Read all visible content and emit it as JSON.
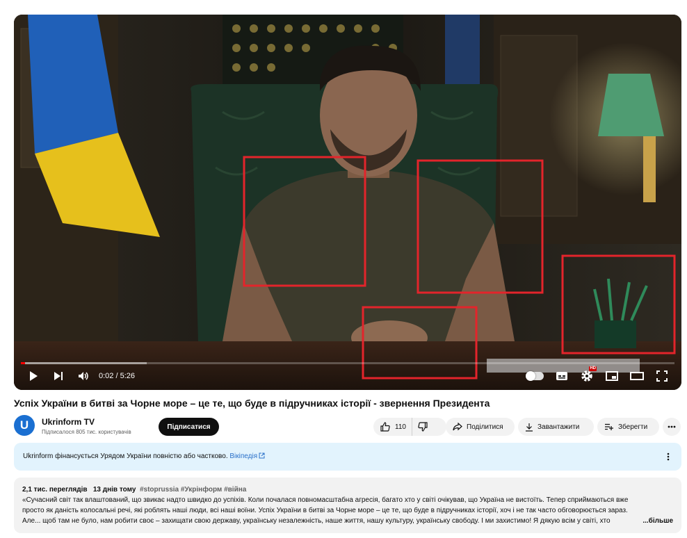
{
  "player": {
    "time_current": "0:02",
    "time_separator": " / ",
    "time_total": "5:26",
    "progress_fraction": 0.0061,
    "hd_badge": "HD",
    "colors": {
      "progress": "#ff0000",
      "highlight_box": "#e3242b"
    }
  },
  "video": {
    "title": "Успіх України в битві за Чорне море – це те, що буде в підручниках історії - звернення Президента"
  },
  "channel": {
    "avatar_letter": "U",
    "name": "Ukrinform TV",
    "subscribers": "Підписалося 805 тис. користувачів",
    "subscribe_label": "Підписатися"
  },
  "actions": {
    "like_count": "110",
    "share_label": "Поділитися",
    "download_label": "Завантажити",
    "save_label": "Зберегти"
  },
  "info_panel": {
    "text": "Ukrinform фінансується Урядом України повністю або частково.",
    "link": "Вікіпедія"
  },
  "description": {
    "views": "2,1 тис. переглядів",
    "date": "13 днів тому",
    "hashtags": "#stoprussia #Укрінформ #війна",
    "line1": "«Сучасний світ так влаштований, що звикає надто швидко до успіхів. Коли почалася повномасштабна агресія, багато хто у світі очікував, що Україна не вистоїть. Тепер сприймаються вже",
    "line2": "просто як даність колосальні речі, які роблять наші люди, всі наші воїни. Успіх України в битві за Чорне море – це те, що буде в підручниках історії, хоч і не так часто обговорюється зараз.",
    "line3": "Але... щоб там не було, нам робити своє – захищати свою державу, українську незалежність, наше життя, нашу культуру, українську свободу. І ми захистимо! Я дякую всім у світі, хто",
    "more_label": "...більше"
  }
}
